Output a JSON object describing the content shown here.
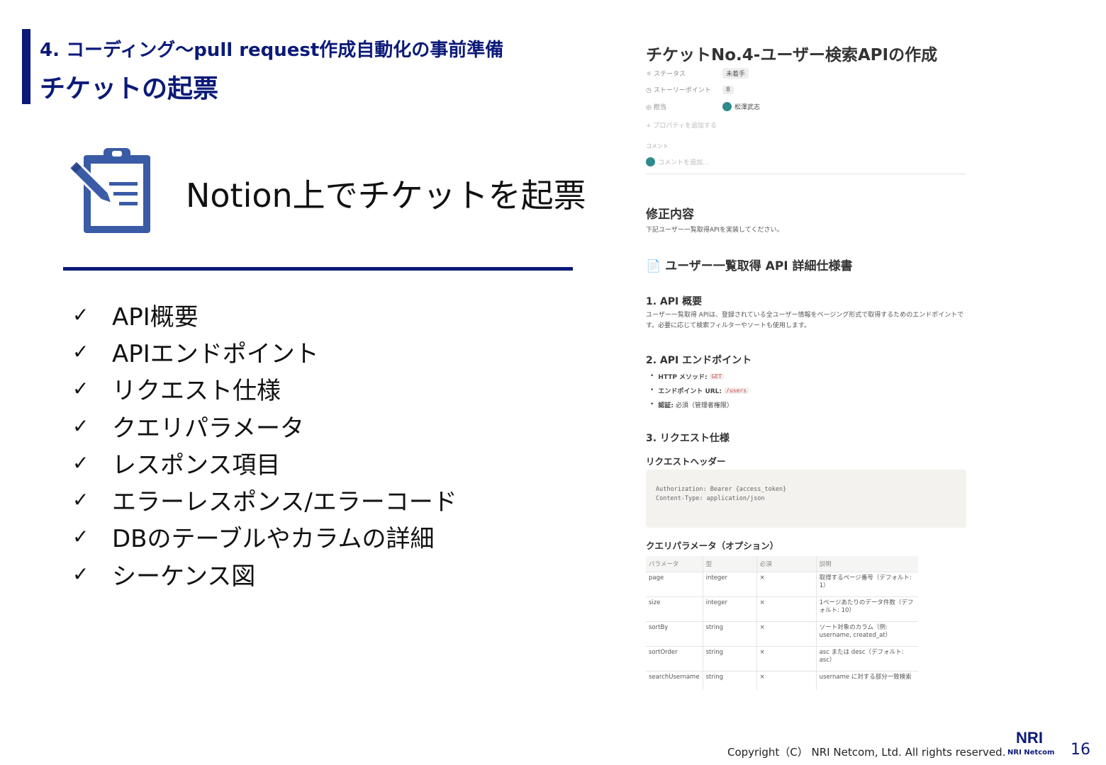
{
  "header": {
    "subtitle": "4. コーディング～pull request作成自動化の事前準備",
    "title": "チケットの起票"
  },
  "left": {
    "headline": "Notion上でチケットを起票",
    "check_mark": "✓",
    "items": [
      "API概要",
      "APIエンドポイント",
      "リクエスト仕様",
      "クエリパラメータ",
      "レスポンス項目",
      "エラーレスポンス/エラーコード",
      "DBのテーブルやカラムの詳細",
      "シーケンス図"
    ]
  },
  "notion": {
    "title": "チケットNo.4-ユーザー検索APIの作成",
    "props": {
      "status_label": "ステータス",
      "status_value": "未着手",
      "points_label": "ストーリーポイント",
      "points_value": "8",
      "assignee_label": "担当",
      "assignee_value": "松澤武志",
      "add_property": "+ プロパティを追加する",
      "comment_label": "コメント",
      "comment_placeholder": "コメントを追加..."
    },
    "section_title": "修正内容",
    "section_text": "下記ユーザー一覧取得APIを実装してください。",
    "doc_title": "ユーザー一覧取得 API 詳細仕様書",
    "h_overview": "1. API 概要",
    "overview_text": "ユーザー一覧取得 APIは、登録されている全ユーザー情報をページング形式で取得するためのエンドポイントです。必要に応じて検索フィルターやソートも使用します。",
    "h_endpoint": "2. API エンドポイント",
    "bullets": {
      "method_label": "HTTP メソッド:",
      "method_value": "GET",
      "url_label": "エンドポイント URL:",
      "url_value": "/users",
      "auth_label": "認証:",
      "auth_value": "必須（管理者権限）"
    },
    "h_request": "3. リクエスト仕様",
    "h_request_header": "リクエストヘッダー",
    "code_line1": "Authorization: Bearer {access_token}",
    "code_line2": "Content-Type: application/json",
    "h_query": "クエリパラメータ（オプション）",
    "table": {
      "headers": [
        "パラメータ",
        "型",
        "必須",
        "説明"
      ],
      "rows": [
        [
          "page",
          "integer",
          "×",
          "取得するページ番号（デフォルト: 1）"
        ],
        [
          "size",
          "integer",
          "×",
          "1ページあたりのデータ件数（デフォルト: 10）"
        ],
        [
          "sortBy",
          "string",
          "×",
          "ソート対象のカラム（例: username, created_at）"
        ],
        [
          "sortOrder",
          "string",
          "×",
          "asc または desc（デフォルト: asc）"
        ],
        [
          "searchUsername",
          "string",
          "×",
          "username に対する部分一致検索"
        ]
      ]
    }
  },
  "footer": {
    "copyright": "Copyright（C） NRI Netcom, Ltd. All rights reserved.",
    "logo_text": "NRI",
    "company": "NRI Netcom",
    "page": "16"
  },
  "colors": {
    "brand": "#0b1a78",
    "icon": "#3a5ba5"
  }
}
